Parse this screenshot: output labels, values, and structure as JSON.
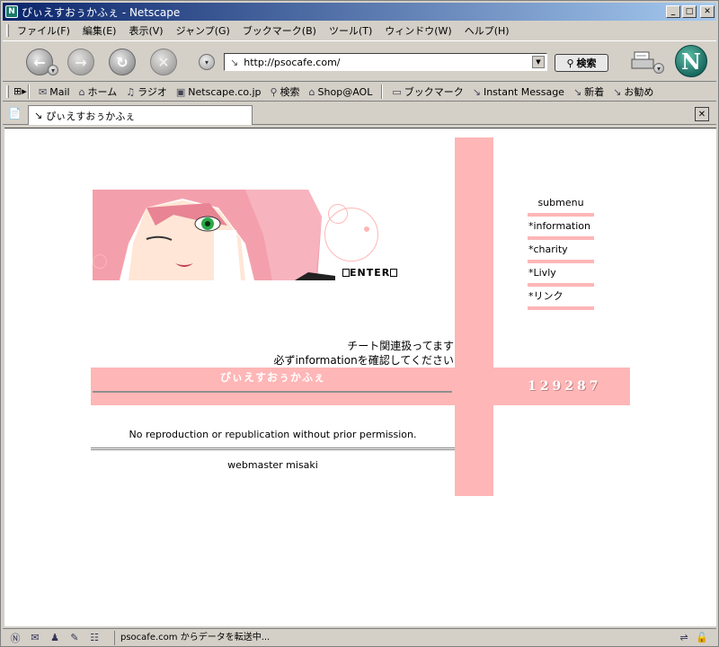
{
  "window": {
    "title": "ぴぃえすおぅかふぇ - Netscape",
    "app_icon": "N"
  },
  "menu": [
    "ファイル(F)",
    "編集(E)",
    "表示(V)",
    "ジャンプ(G)",
    "ブックマーク(B)",
    "ツール(T)",
    "ウィンドウ(W)",
    "ヘルプ(H)"
  ],
  "nav": {
    "url": "http://psocafe.com/",
    "search_label": "検索",
    "logo": "N"
  },
  "personal_toolbar": [
    {
      "icon": "mail-icon",
      "glyph": "✉",
      "label": "Mail"
    },
    {
      "icon": "home-icon",
      "glyph": "⌂",
      "label": "ホーム"
    },
    {
      "icon": "headphones-icon",
      "glyph": "♫",
      "label": "ラジオ"
    },
    {
      "icon": "my-icon",
      "glyph": "▣",
      "label": "Netscape.co.jp"
    },
    {
      "icon": "search-icon",
      "glyph": "⚲",
      "label": "検索"
    },
    {
      "icon": "aol-icon",
      "glyph": "⌂",
      "label": "Shop@AOL"
    },
    {
      "icon": "folder-icon",
      "glyph": "▭",
      "label": "ブックマーク"
    },
    {
      "icon": "link-icon",
      "glyph": "↘",
      "label": "Instant Message"
    },
    {
      "icon": "link-icon",
      "glyph": "↘",
      "label": "新着"
    },
    {
      "icon": "link-icon",
      "glyph": "↘",
      "label": "お勧め"
    }
  ],
  "tab": {
    "label": "ぴぃえすおぅかふぇ"
  },
  "page": {
    "enter_label": "ENTER",
    "submenu": {
      "heading": "submenu",
      "items": [
        "*information",
        "*charity",
        "*Livly",
        "*リンク"
      ]
    },
    "notice_line1": "チート関連扱ってます",
    "notice_line2": "必ずinformationを確認してください",
    "site_title": "ぴぃえすおぅかふぇ",
    "counter": "129287",
    "copyright": "No reproduction or republication without prior permission.",
    "webmaster": "webmaster misaki"
  },
  "status": {
    "text": "psocafe.com からデータを転送中..."
  },
  "colors": {
    "pink": "#ffb6b6",
    "chrome": "#d4d0c8",
    "title_blue": "#0a246a"
  }
}
